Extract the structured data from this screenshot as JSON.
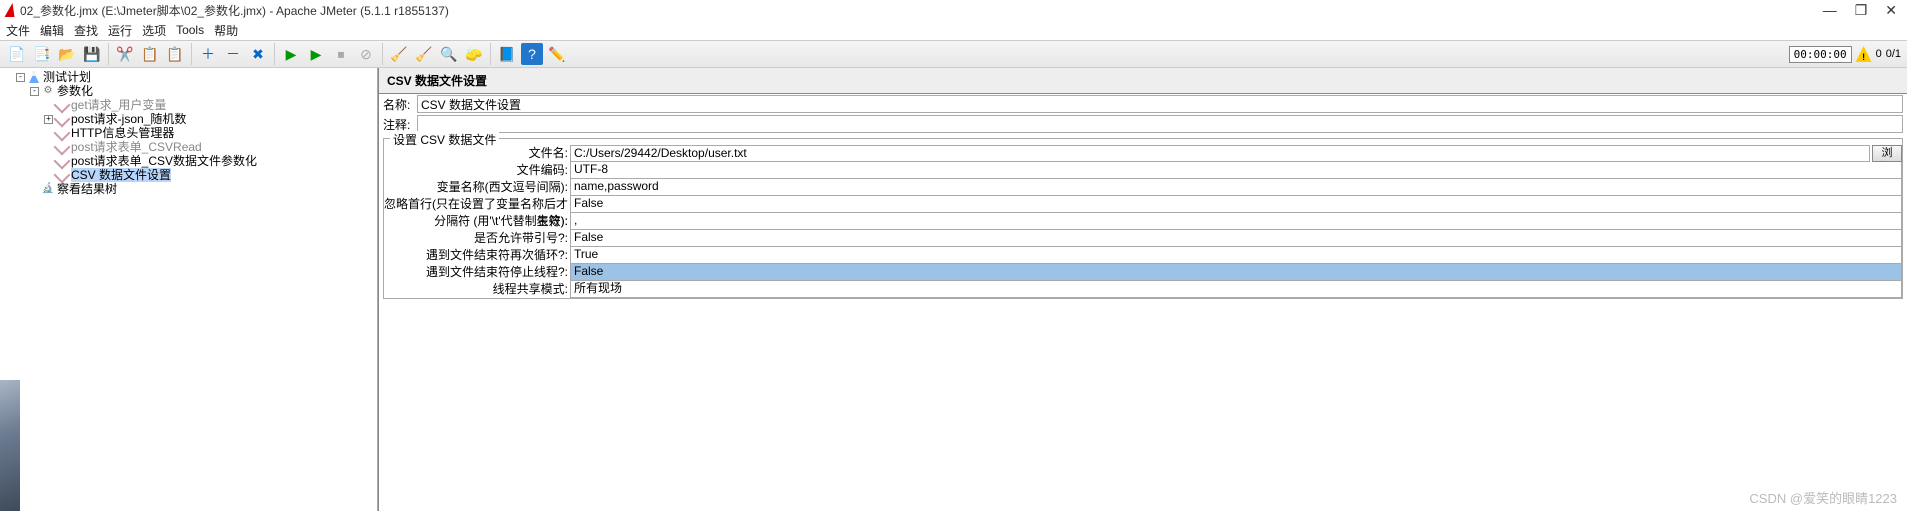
{
  "window": {
    "title": "02_参数化.jmx (E:\\Jmeter脚本\\02_参数化.jmx) - Apache JMeter (5.1.1 r1855137)",
    "minimize": "—",
    "maximize": "❐",
    "close": "✕"
  },
  "menu": [
    "文件",
    "编辑",
    "查找",
    "运行",
    "选项",
    "Tools",
    "帮助"
  ],
  "toolbar": {
    "timer": "00:00:00",
    "warn_count": "0",
    "thread_count": "0/1"
  },
  "tree": {
    "items": [
      {
        "label": "测试计划",
        "indent": 1,
        "icon": "ico-flask",
        "twisty": "-"
      },
      {
        "label": "参数化",
        "indent": 2,
        "icon": "ico-gear",
        "twisty": "-",
        "iconText": "⚙"
      },
      {
        "label": "get请求_用户变量",
        "indent": 3,
        "icon": "ico-pipette",
        "twisty": " ",
        "grey": true
      },
      {
        "label": "post请求-json_随机数",
        "indent": 3,
        "icon": "ico-pipette",
        "twisty": "+"
      },
      {
        "label": "HTTP信息头管理器",
        "indent": 3,
        "icon": "ico-pipette",
        "twisty": " "
      },
      {
        "label": "post请求表单_CSVRead",
        "indent": 3,
        "icon": "ico-pipette",
        "twisty": " ",
        "grey": true
      },
      {
        "label": "post请求表单_CSV数据文件参数化",
        "indent": 3,
        "icon": "ico-pipette",
        "twisty": " "
      },
      {
        "label": "CSV 数据文件设置",
        "indent": 3,
        "icon": "ico-pipette",
        "twisty": " ",
        "selected": true
      },
      {
        "label": "察看结果树",
        "indent": 2,
        "icon": "ico-scope",
        "twisty": " ",
        "iconText": "🔬"
      }
    ]
  },
  "panel": {
    "header": "CSV 数据文件设置",
    "name_label": "名称:",
    "name_value": "CSV 数据文件设置",
    "comment_label": "注释:",
    "comment_value": "",
    "fieldset_legend": "设置 CSV 数据文件",
    "rows": [
      {
        "label": "文件名:",
        "value": "C:/Users/29442/Desktop/user.txt",
        "browse": "浏览..."
      },
      {
        "label": "文件编码:",
        "value": "UTF-8"
      },
      {
        "label": "变量名称(西文逗号间隔):",
        "value": "name,password"
      },
      {
        "label": "忽略首行(只在设置了变量名称后才生效):",
        "value": "False"
      },
      {
        "label": "分隔符 (用'\\t'代替制表符):",
        "value": ","
      },
      {
        "label": "是否允许带引号?:",
        "value": "False"
      },
      {
        "label": "遇到文件结束符再次循环?:",
        "value": "True"
      },
      {
        "label": "遇到文件结束符停止线程?:",
        "value": "False",
        "selected": true
      },
      {
        "label": "线程共享模式:",
        "value": "所有现场"
      }
    ]
  },
  "watermark": "CSDN @爱笑的眼睛1223"
}
